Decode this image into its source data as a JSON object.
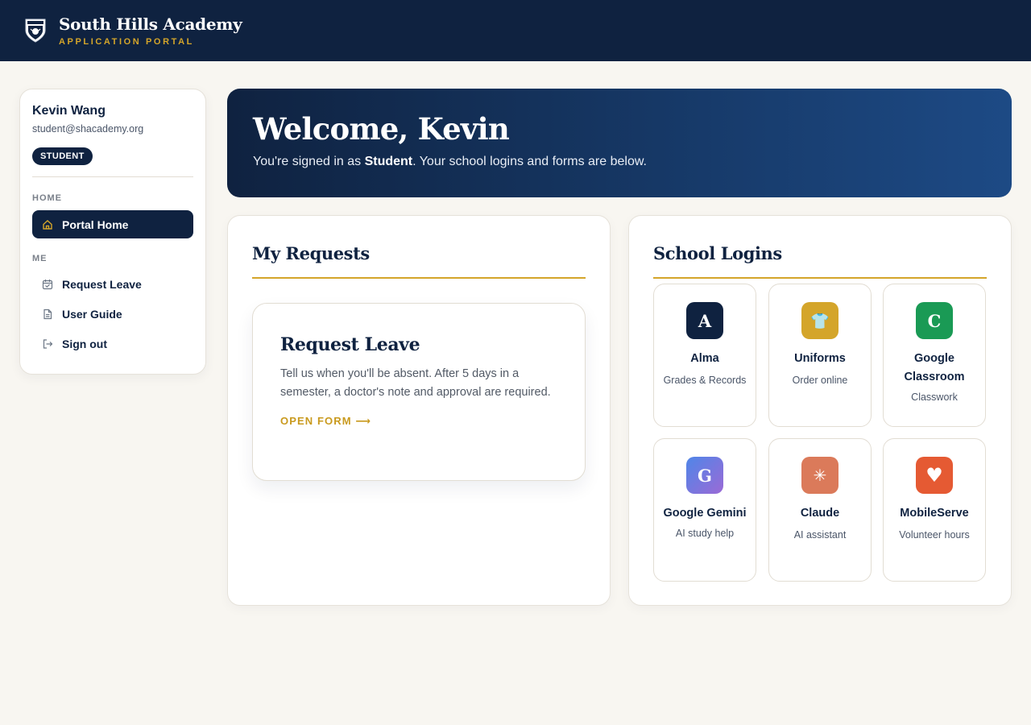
{
  "header": {
    "title": "South Hills Academy",
    "subtitle": "APPLICATION PORTAL",
    "logo_icon": "school-crest-icon"
  },
  "sidebar": {
    "user_name": "Kevin Wang",
    "user_email": "student@shacademy.org",
    "role_badge": "STUDENT",
    "section_home": "HOME",
    "section_me": "ME",
    "items": [
      {
        "label": "Portal Home",
        "icon": "home-icon",
        "active": true
      },
      {
        "label": "Request Leave",
        "icon": "calendar-icon",
        "active": false
      },
      {
        "label": "User Guide",
        "icon": "document-icon",
        "active": false
      },
      {
        "label": "Sign out",
        "icon": "sign-out-icon",
        "active": false
      }
    ]
  },
  "hero": {
    "title": "Welcome, Kevin",
    "text_prefix": "You're signed in as ",
    "role": "Student",
    "text_suffix": ". Your school logins and forms are below."
  },
  "requests": {
    "title": "My Requests",
    "card_title": "Request Leave",
    "card_description": "Tell us when you'll be absent. After 5 days in a semester, a doctor's note and approval are required.",
    "card_link": "OPEN FORM ⟶"
  },
  "logins": {
    "title": "School Logins",
    "tiles": [
      {
        "name": "Alma",
        "subtitle": "Grades & Records",
        "glyph": "A",
        "color": "#0f2240"
      },
      {
        "name": "Uniforms",
        "subtitle": "Order online",
        "glyph": "👕",
        "color": "#d4a52a"
      },
      {
        "name": "Google Classroom",
        "subtitle": "Classwork",
        "glyph": "C",
        "color": "#1a9a55"
      },
      {
        "name": "Google Gemini",
        "subtitle": "AI study help",
        "glyph": "G",
        "color": "#5b7be8"
      },
      {
        "name": "Claude",
        "subtitle": "AI assistant",
        "glyph": "✳",
        "color": "#db7a5a"
      },
      {
        "name": "MobileServe",
        "subtitle": "Volunteer hours",
        "glyph": "♥",
        "color": "#e55a33"
      }
    ]
  },
  "colors": {
    "navy": "#0f2240",
    "gold": "#d4a52a",
    "background": "#f8f6f1"
  }
}
